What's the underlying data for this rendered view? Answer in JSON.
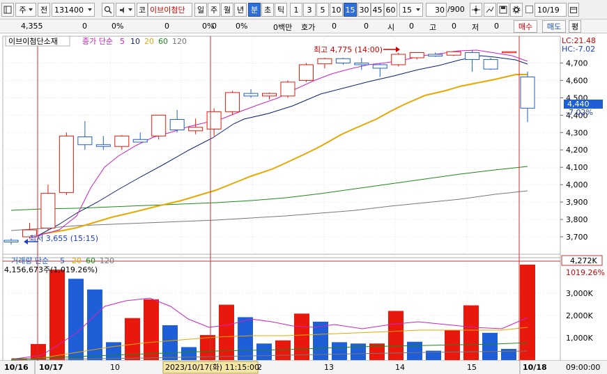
{
  "toolbar": {
    "tab_marker": "주",
    "tab_type": "전",
    "code": "131400",
    "market": "코",
    "name": "이브이첨단",
    "periods": [
      "일",
      "주",
      "월",
      "년",
      "분",
      "초",
      "틱"
    ],
    "active_period": "분",
    "intervals": [
      "1",
      "3",
      "5",
      "10",
      "15",
      "30",
      "45",
      "60"
    ],
    "active_interval": "15",
    "interval_value": "15",
    "count": "30",
    "count_max": "/900",
    "date": "10/19"
  },
  "quote": {
    "price": "4,355",
    "v1": "0",
    "p1": "0%",
    "v2": "0",
    "p2": "0%",
    "v3": "0",
    "p3": "0%",
    "amount": "0백만",
    "hoga_label": "호가",
    "hoga": "0",
    "hoga2": "0",
    "open_label": "시",
    "open": "0",
    "high_label": "고",
    "high": "0",
    "low_label": "저",
    "low": "0",
    "buy": "매수",
    "sell": "매도",
    "eval": "평"
  },
  "price_panel": {
    "name": "이브이첨단소재",
    "ma_label": "종가 단순",
    "ma_periods": [
      "5",
      "10",
      "20",
      "60",
      "120"
    ],
    "high_note": "최고 4,775 (14:00)",
    "low_note": "최저 3,655 (15:15)",
    "lc": "LC:21.48",
    "hc": "HC:-7.02",
    "current_price": "4,440",
    "current_change": "-7.02%",
    "yticks": [
      "4,700",
      "4,600",
      "4,500",
      "4,400",
      "4,300",
      "4,200",
      "4,100",
      "4,000",
      "3,900",
      "3,800",
      "3,700"
    ]
  },
  "volume_panel": {
    "title": "거래량 단순",
    "ma_periods": [
      "5",
      "20",
      "60",
      "120"
    ],
    "value_note": "4,156,673주(1,019.26%)",
    "current_volume": "4,272K",
    "current_ratio": "1019.26%",
    "yticks": [
      "3,000K",
      "2,000K",
      "1,000K"
    ]
  },
  "xaxis": {
    "labels": [
      "10/16",
      "10/17",
      "10",
      "12",
      "13",
      "14",
      "15",
      "10/18"
    ],
    "cursor_label": "2023/10/17(화) 11:15:00",
    "time_label": "09:00:00"
  },
  "colors": {
    "up": "#e8180c",
    "down": "#1e5ed6",
    "ma5": "#d020c0",
    "ma10": "#0a1e78",
    "ma20": "#e8a800",
    "ma60": "#1a8a1a",
    "ma120": "#777777",
    "cursor": "#c83232"
  },
  "chart_data": {
    "type": "candlestick",
    "ylim": [
      3620,
      4830
    ],
    "candles": [
      {
        "o": 3680,
        "h": 3690,
        "l": 3655,
        "c": 3670
      },
      {
        "o": 3700,
        "h": 3780,
        "l": 3690,
        "c": 3740
      },
      {
        "o": 3750,
        "h": 4000,
        "l": 3740,
        "c": 3950
      },
      {
        "o": 3955,
        "h": 4300,
        "l": 3940,
        "c": 4280
      },
      {
        "o": 4275,
        "h": 4365,
        "l": 4200,
        "c": 4230
      },
      {
        "o": 4230,
        "h": 4280,
        "l": 4200,
        "c": 4220
      },
      {
        "o": 4220,
        "h": 4285,
        "l": 4200,
        "c": 4280
      },
      {
        "o": 4260,
        "h": 4300,
        "l": 4250,
        "c": 4245
      },
      {
        "o": 4280,
        "h": 4400,
        "l": 4260,
        "c": 4400
      },
      {
        "o": 4375,
        "h": 4430,
        "l": 4300,
        "c": 4315
      },
      {
        "o": 4310,
        "h": 4380,
        "l": 4290,
        "c": 4330
      },
      {
        "o": 4320,
        "h": 4440,
        "l": 4280,
        "c": 4420
      },
      {
        "o": 4420,
        "h": 4540,
        "l": 4400,
        "c": 4530
      },
      {
        "o": 4525,
        "h": 4550,
        "l": 4500,
        "c": 4510
      },
      {
        "o": 4510,
        "h": 4530,
        "l": 4490,
        "c": 4525
      },
      {
        "o": 4510,
        "h": 4600,
        "l": 4500,
        "c": 4590
      },
      {
        "o": 4600,
        "h": 4700,
        "l": 4590,
        "c": 4690
      },
      {
        "o": 4695,
        "h": 4730,
        "l": 4670,
        "c": 4725
      },
      {
        "o": 4725,
        "h": 4730,
        "l": 4690,
        "c": 4700
      },
      {
        "o": 4700,
        "h": 4730,
        "l": 4660,
        "c": 4690
      },
      {
        "o": 4690,
        "h": 4700,
        "l": 4620,
        "c": 4670
      },
      {
        "o": 4690,
        "h": 4760,
        "l": 4680,
        "c": 4750
      },
      {
        "o": 4730,
        "h": 4760,
        "l": 4720,
        "c": 4760
      },
      {
        "o": 4750,
        "h": 4760,
        "l": 4735,
        "c": 4740
      },
      {
        "o": 4745,
        "h": 4770,
        "l": 4740,
        "c": 4765
      },
      {
        "o": 4760,
        "h": 4775,
        "l": 4650,
        "c": 4720
      },
      {
        "o": 4720,
        "h": 4730,
        "l": 4660,
        "c": 4665
      },
      {
        "o": 4760,
        "h": 4765,
        "l": 4760,
        "c": 4765
      },
      {
        "o": 4620,
        "h": 4650,
        "l": 4360,
        "c": 4440
      }
    ],
    "volume": [
      80,
      720,
      4050,
      3640,
      3160,
      800,
      1880,
      2720,
      1560,
      580,
      1120,
      2480,
      1920,
      740,
      880,
      2080,
      1720,
      800,
      740,
      740,
      2200,
      820,
      420,
      1330,
      2450,
      1220,
      500,
      4272
    ]
  }
}
